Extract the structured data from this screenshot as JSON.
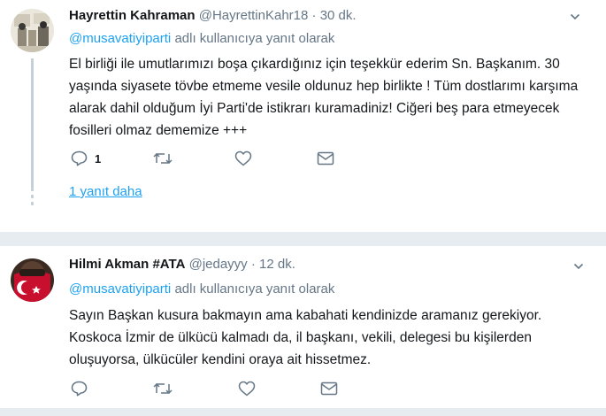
{
  "tweets": [
    {
      "name": "Hayrettin Kahraman",
      "handle": "@HayrettinKahr18",
      "sep": "·",
      "time": "30 dk.",
      "reply_mention": "@musavatiyiparti",
      "reply_suffix": "adlı kullanıcıya yanıt olarak",
      "body": "El birliği ile umutlarımızı boşa çıkardığınız için teşekkür ederim Sn. Başkanım. 30 yaşında siyasete tövbe etmeme vesile oldunuz hep birlikte ! Tüm dostlarımı karşıma alarak dahil olduğum İyi Parti'de istikrarı kuramadiniz! Ciğeri beş para etmeyecek fosilleri olmaz dememize +++",
      "reply_count": "1",
      "more_replies": "1 yanıt daha"
    },
    {
      "name": "Hilmi Akman #ATA",
      "handle": "@jedayyy",
      "sep": "·",
      "time": "12 dk.",
      "reply_mention": "@musavatiyiparti",
      "reply_suffix": "adlı kullanıcıya yanıt olarak",
      "body": "Sayın Başkan kusura bakmayın ama kabahati kendinizde aramanız gerekiyor. Koskoca İzmir de ülkücü kalmadı da, il başkanı, vekili, delegesi bu kişilerden oluşuyorsa, ülkücüler kendini oraya ait hissetmez."
    }
  ],
  "icons": {
    "reply": "reply-icon",
    "retweet": "retweet-icon",
    "like": "heart-icon",
    "dm": "envelope-icon",
    "caret": "chevron-down-icon"
  },
  "colors": {
    "link": "#1da1f2",
    "muted": "#657786",
    "text": "#14171a",
    "divider": "#e6ecf0"
  }
}
